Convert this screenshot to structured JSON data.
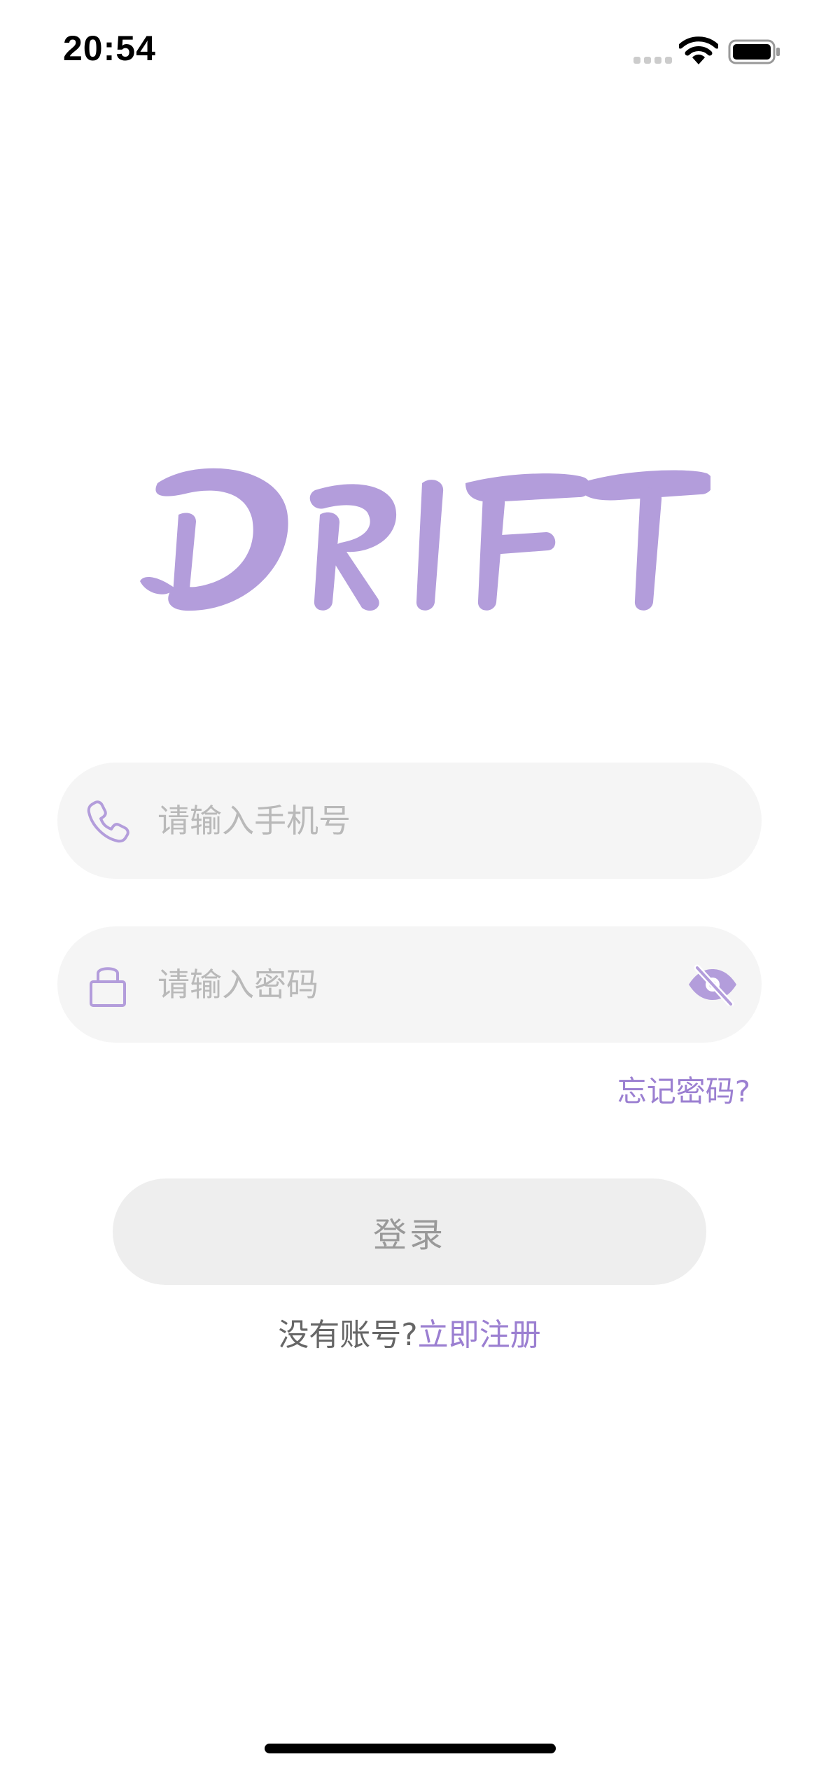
{
  "status_bar": {
    "time": "20:54"
  },
  "logo": {
    "text": "DRIFT",
    "color": "#b39ddb"
  },
  "form": {
    "phone": {
      "placeholder": "请输入手机号",
      "value": "",
      "icon": "phone-icon"
    },
    "password": {
      "placeholder": "请输入密码",
      "value": "",
      "icon": "lock-icon",
      "toggle_icon": "eye-off-icon"
    },
    "forgot_password": "忘记密码?",
    "login_label": "登录",
    "register_prompt": "没有账号?",
    "register_link": "立即注册"
  },
  "colors": {
    "accent": "#9b7fd1",
    "field_bg": "#f5f5f5",
    "button_bg": "#eeeeee",
    "placeholder": "#b9b9b9"
  }
}
